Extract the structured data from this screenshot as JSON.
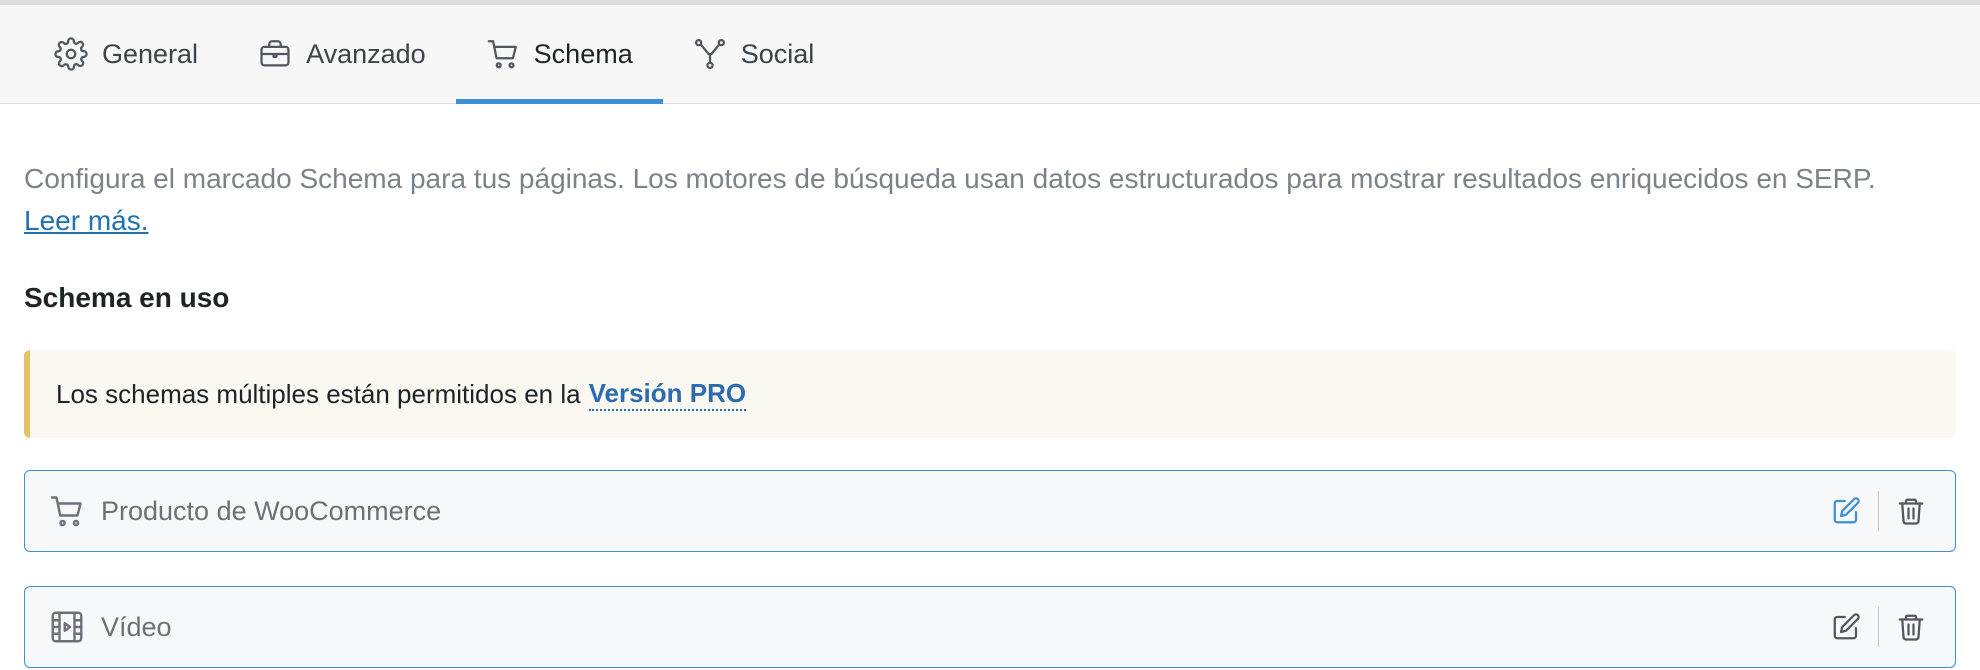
{
  "tabs": [
    {
      "label": "General",
      "icon": "gear-icon"
    },
    {
      "label": "Avanzado",
      "icon": "briefcase-icon"
    },
    {
      "label": "Schema",
      "icon": "cart-icon",
      "active": true
    },
    {
      "label": "Social",
      "icon": "share-nodes-icon"
    }
  ],
  "description": {
    "text": "Configura el marcado Schema para tus páginas. Los motores de búsqueda usan datos estructurados para mostrar resultados enriquecidos en SERP.",
    "link": "Leer más."
  },
  "section_title": "Schema en uso",
  "notice": {
    "text": "Los schemas múltiples están permitidos en la",
    "link": "Versión PRO"
  },
  "schemas": [
    {
      "name": "Producto de WooCommerce",
      "icon": "cart-icon"
    },
    {
      "name": "Vídeo",
      "icon": "film-icon"
    }
  ],
  "colors": {
    "accent": "#3d8fd8",
    "notice_border": "#e6c267",
    "notice_bg": "#fbf7f1",
    "link": "#2271b1"
  }
}
